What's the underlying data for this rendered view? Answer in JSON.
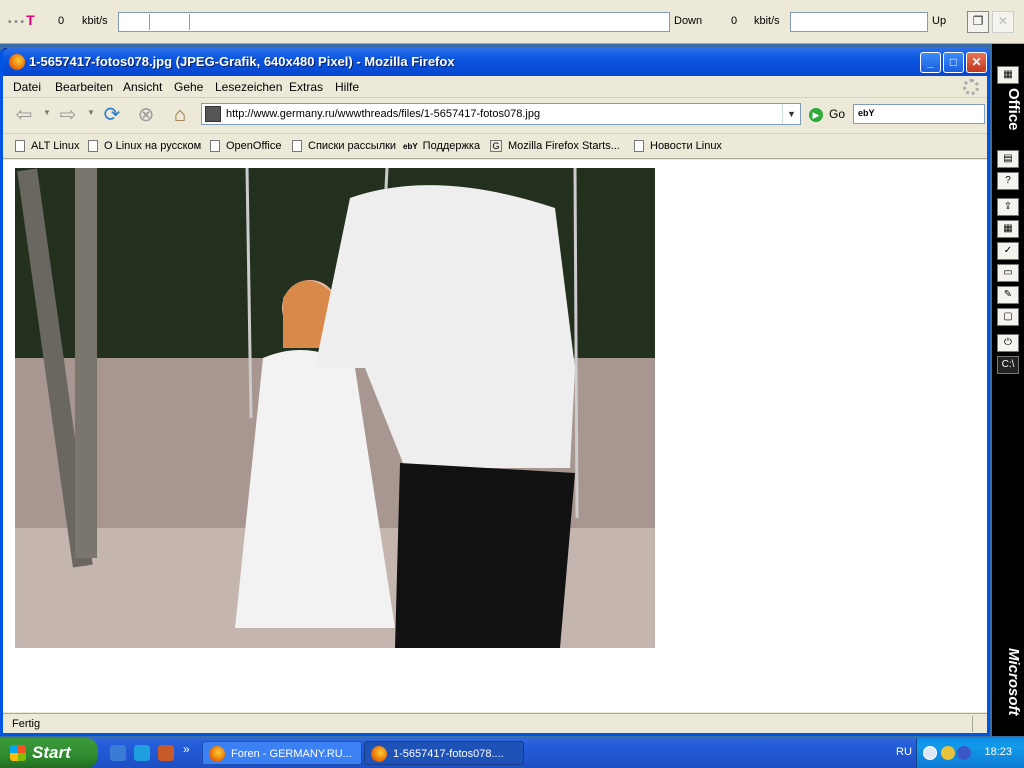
{
  "topbar": {
    "down_value": "0",
    "down_unit": "kbit/s",
    "down_label": "Down",
    "up_value": "0",
    "up_unit": "kbit/s",
    "up_label": "Up"
  },
  "window": {
    "title": "1-5657417-fotos078.jpg (JPEG-Grafik, 640x480 Pixel) - Mozilla Firefox"
  },
  "menu": {
    "items": [
      "Datei",
      "Bearbeiten",
      "Ansicht",
      "Gehe",
      "Lesezeichen",
      "Extras",
      "Hilfe"
    ]
  },
  "navbar": {
    "url": "http://www.germany.ru/wwwthreads/files/1-5657417-fotos078.jpg",
    "go_label": "Go",
    "search_engine": "ebY"
  },
  "bookmarks": [
    "ALT Linux",
    "O Linux на русском",
    "OpenOffice",
    "Списки рассылки",
    "Поддержка",
    "Mozilla Firefox Starts...",
    "Новости Linux"
  ],
  "status": {
    "text": "Fertig"
  },
  "officebar": {
    "label_top": "Office",
    "label_bottom": "Microsoft"
  },
  "taskbar": {
    "start_label": "Start",
    "more": "»",
    "tasks": [
      "Foren - GERMANY.RU...",
      "1-5657417-fotos078...."
    ],
    "lang": "RU",
    "clock": "18:23"
  }
}
